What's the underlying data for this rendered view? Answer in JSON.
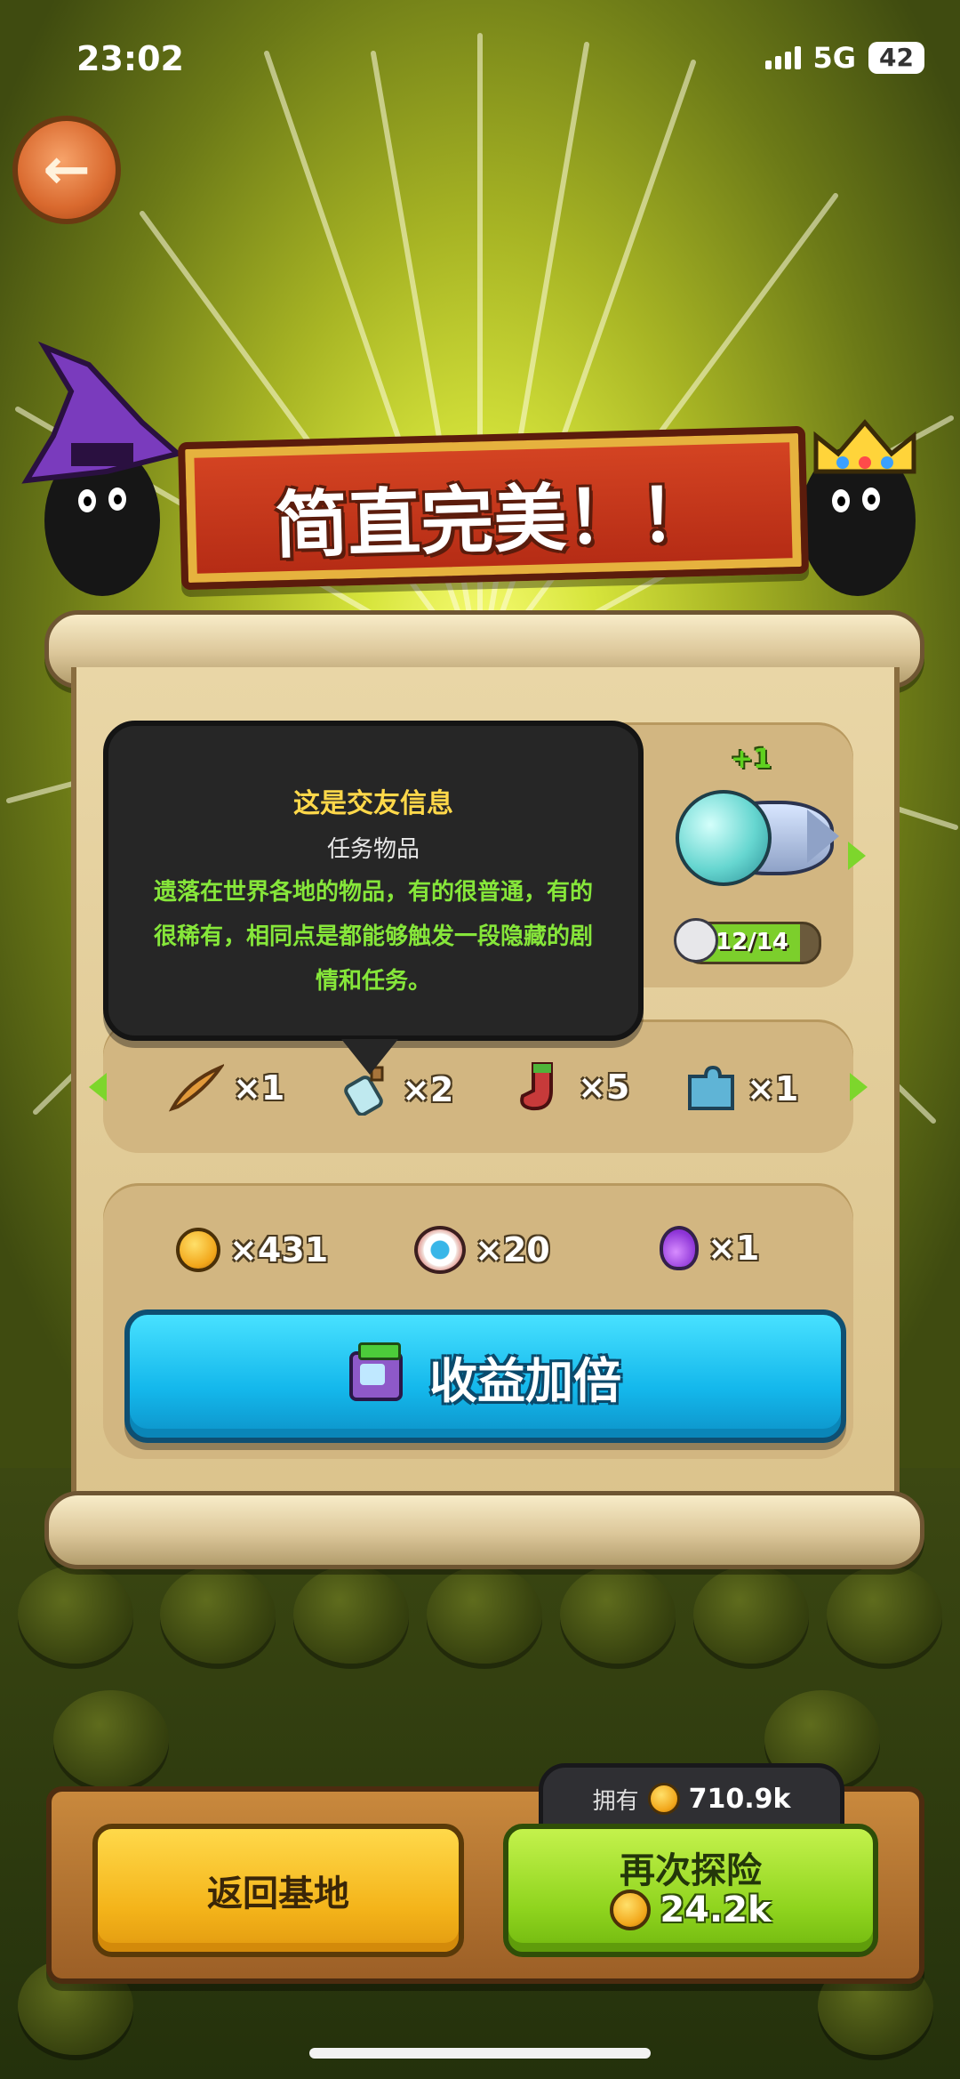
{
  "status_bar": {
    "time": "23:02",
    "network": "5G",
    "battery": "42"
  },
  "back_button": {
    "icon": "back-arrow-icon"
  },
  "banner": {
    "title": "简直完美！！"
  },
  "tooltip": {
    "title": "这是交友信息",
    "subtitle": "任务物品",
    "description": "遗落在世界各地的物品，有的很普通，有的很稀有，相同点是都能够触发一段隐藏的剧情和任务。"
  },
  "reward_pet": {
    "bonus": "+1",
    "progress_text": "12/14",
    "progress_fraction": 0.857,
    "icon": "fish-icon"
  },
  "item_row": {
    "items": [
      {
        "icon": "feather-icon",
        "count": "×1"
      },
      {
        "icon": "bottle-icon",
        "count": "×2"
      },
      {
        "icon": "sock-icon",
        "count": "×5"
      },
      {
        "icon": "puzzle-icon",
        "count": "×1"
      }
    ]
  },
  "loot_row": {
    "items": [
      {
        "icon": "coin-icon",
        "count": "×431"
      },
      {
        "icon": "eyeball-icon",
        "count": "×20"
      },
      {
        "icon": "potion-icon",
        "count": "×1"
      }
    ]
  },
  "double_button": {
    "label": "收益加倍",
    "icon": "tv-icon"
  },
  "bottom": {
    "owned_label": "拥有",
    "owned_value": "710.9k",
    "home_button": "返回基地",
    "again_button": "再次探险",
    "again_cost": "24.2k"
  },
  "colors": {
    "accent_green": "#7dd62c",
    "button_blue": "#14b8ec",
    "button_yellow": "#f4b41a",
    "banner_red": "#c8361a"
  }
}
